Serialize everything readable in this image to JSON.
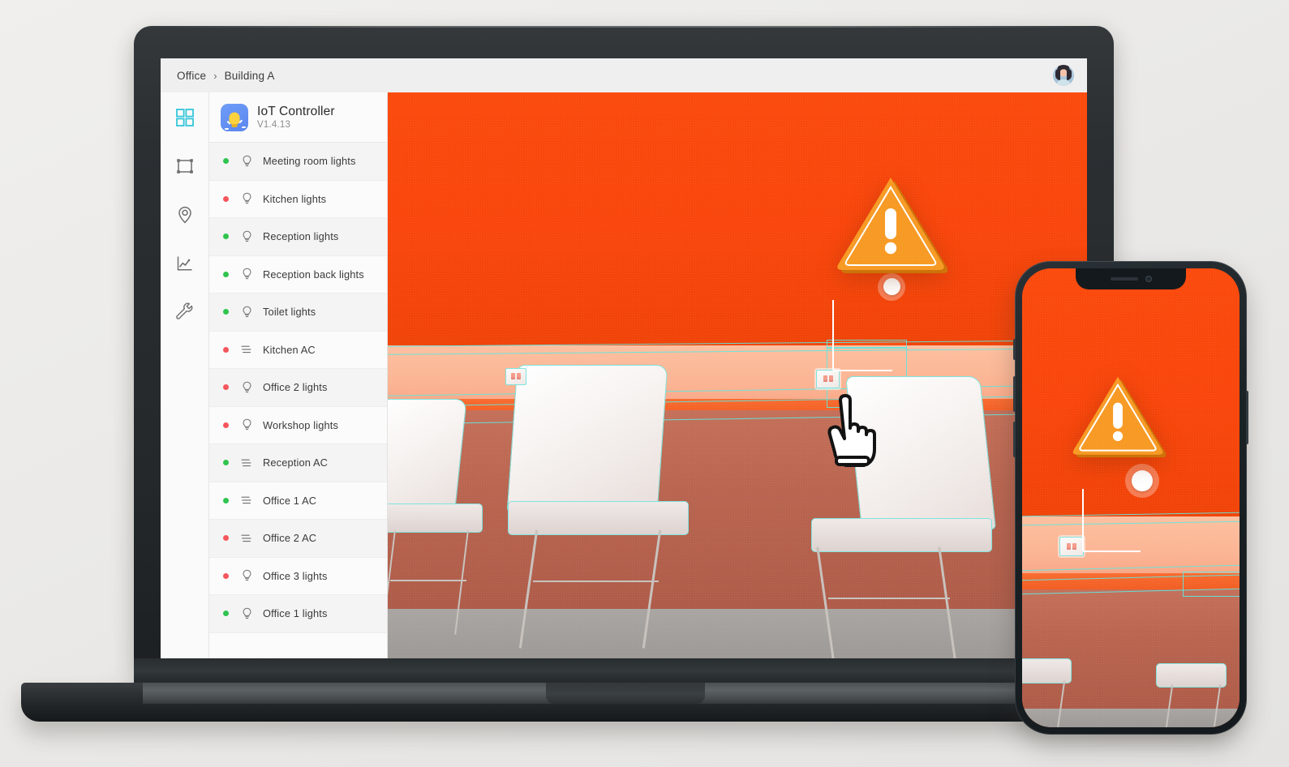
{
  "breadcrumb": {
    "root": "Office",
    "separator": "›",
    "current": "Building A"
  },
  "user": {
    "avatar_label": "user-avatar"
  },
  "rail": {
    "items": [
      {
        "name": "grid-icon",
        "label": "Dashboard",
        "active": true
      },
      {
        "name": "frame-icon",
        "label": "Areas",
        "active": false
      },
      {
        "name": "location-icon",
        "label": "Locations",
        "active": false
      },
      {
        "name": "chart-icon",
        "label": "Analytics",
        "active": false
      },
      {
        "name": "wrench-icon",
        "label": "Settings",
        "active": false
      }
    ],
    "active_color": "#34C6DA",
    "inactive_color": "#6E6E6E"
  },
  "app": {
    "icon": "lightbulb-icon",
    "title": "IoT Controller",
    "version": "V1.4.13"
  },
  "status_colors": {
    "on": "#2FC44F",
    "off": "#F4565C"
  },
  "devices": [
    {
      "label": "Meeting room lights",
      "status": "on",
      "type": "bulb"
    },
    {
      "label": "Kitchen lights",
      "status": "off",
      "type": "bulb"
    },
    {
      "label": "Reception lights",
      "status": "on",
      "type": "bulb"
    },
    {
      "label": "Reception back lights",
      "status": "on",
      "type": "bulb"
    },
    {
      "label": "Toilet lights",
      "status": "on",
      "type": "bulb"
    },
    {
      "label": "Kitchen AC",
      "status": "off",
      "type": "ac"
    },
    {
      "label": "Office 2 lights",
      "status": "off",
      "type": "bulb"
    },
    {
      "label": "Workshop lights",
      "status": "off",
      "type": "bulb"
    },
    {
      "label": "Reception AC",
      "status": "on",
      "type": "ac"
    },
    {
      "label": "Office 1 AC",
      "status": "on",
      "type": "ac"
    },
    {
      "label": "Office 2 AC",
      "status": "off",
      "type": "ac"
    },
    {
      "label": "Office 3 lights",
      "status": "off",
      "type": "bulb"
    },
    {
      "label": "Office 1 lights",
      "status": "on",
      "type": "bulb"
    }
  ],
  "viewport": {
    "scene": "office-camera-view",
    "ar_overlay_color": "#5FE7DF",
    "warning": {
      "icon": "warning-triangle-icon",
      "fill": "#F79A24",
      "mark": "!"
    },
    "marker": {
      "icon": "map-pin-dot",
      "color": "#FFFFFF"
    },
    "target": {
      "icon": "power-outlet-icon"
    },
    "cursor": {
      "icon": "pointing-hand-cursor"
    }
  }
}
